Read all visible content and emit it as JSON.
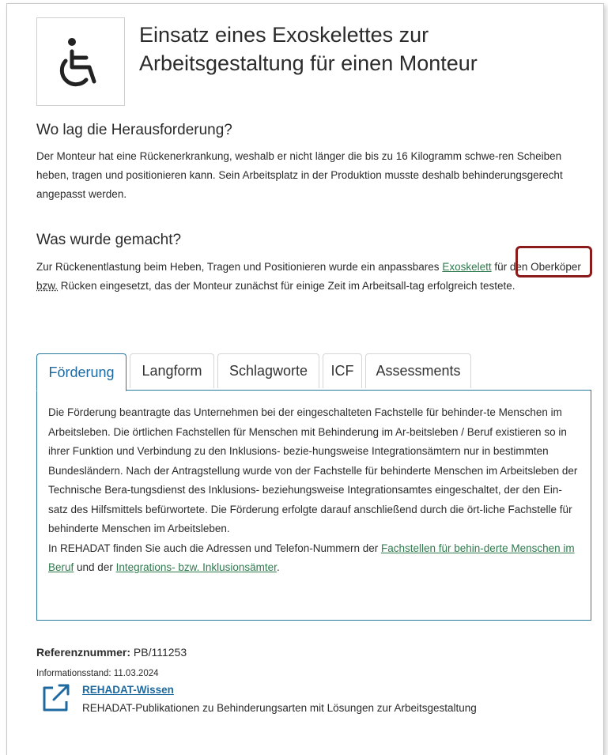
{
  "header": {
    "icon": "wheelchair-icon",
    "title": "Einsatz eines Exoskelettes zur Arbeitsgestaltung für einen Monteur"
  },
  "section1": {
    "heading": "Wo lag die Herausforderung?",
    "text": "Der Monteur hat eine Rückenerkrankung, weshalb er nicht länger die bis zu 16 Kilogramm schwe-ren Scheiben heben, tragen und positionieren kann. Sein Arbeitsplatz in der Produktion musste deshalb behinderungsgerecht angepasst werden."
  },
  "section2": {
    "heading": "Was wurde gemacht?",
    "text_before": "Zur Rückenentlastung beim Heben, Tragen und Positionieren wurde ein anpassbares ",
    "link": "Exoskelett",
    "text_middle": " für den Oberköper ",
    "abbr": "bzw.",
    "text_after": " Rücken eingesetzt, das der Monteur zunächst für einige Zeit im Arbeitsall-tag erfolgreich testete."
  },
  "tabs": [
    {
      "label": "Förderung",
      "active": true
    },
    {
      "label": "Langform",
      "active": false
    },
    {
      "label": "Schlagworte",
      "active": false
    },
    {
      "label": "ICF",
      "active": false
    },
    {
      "label": "Assessments",
      "active": false
    }
  ],
  "panel": {
    "text": "Die Förderung beantragte das Unternehmen bei der eingeschalteten Fachstelle für behinder-te Menschen im Arbeitsleben. Die örtlichen Fachstellen für Menschen mit Behinderung im Ar-beitsleben / Beruf existieren so in ihrer Funktion und Verbindung zu den Inklusions- bezie-hungsweise Integrationsämtern nur in bestimmten Bundesländern. Nach der Antragstellung wurde von der Fachstelle für behinderte Menschen im Arbeitsleben der Technische Bera-tungsdienst des Inklusions- beziehungsweise Integrationsamtes eingeschaltet, der den Ein-satz des Hilfsmittels befürwortete. Die Förderung erfolgte darauf anschließend durch die ört-liche Fachstelle für behinderte Menschen im Arbeitsleben.",
    "line2_before": "In REHADAT finden Sie auch die Adressen und Telefon-Nummern der ",
    "link1": "Fachstellen für behin-derte Menschen im Beruf",
    "line2_middle": " und der ",
    "link2": "Integrations- bzw. Inklusionsämter",
    "line2_after": "."
  },
  "reference": {
    "label": "Referenznummer:",
    "value": "PB/111253",
    "info": "Informationsstand: 11.03.2024"
  },
  "wissen": {
    "icon": "external-link-icon",
    "title": "REHADAT-Wissen",
    "description": "REHADAT-Publikationen zu Behinderungsarten mit Lösungen zur Arbeitsgestaltung"
  },
  "colors": {
    "link_green": "#2e7a4d",
    "accent_blue": "#1e6aa0",
    "panel_border": "#2b7a9b",
    "highlight": "#8b1a1a"
  }
}
